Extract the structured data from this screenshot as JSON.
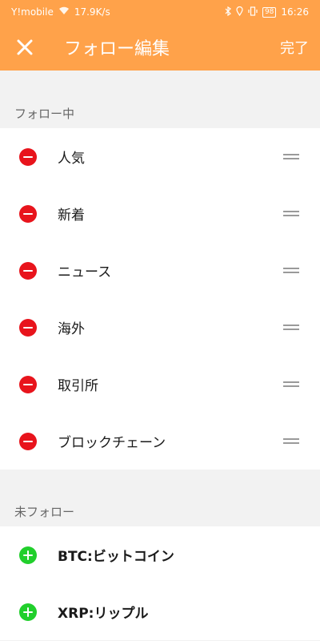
{
  "status_bar": {
    "carrier": "Y!mobile",
    "speed": "17.9K/s",
    "battery": "98",
    "time": "16:26"
  },
  "header": {
    "title": "フォロー編集",
    "done_label": "完了",
    "close_icon": "close-icon"
  },
  "following": {
    "section_label": "フォロー中",
    "items": [
      {
        "label": "人気"
      },
      {
        "label": "新着"
      },
      {
        "label": "ニュース"
      },
      {
        "label": "海外"
      },
      {
        "label": "取引所"
      },
      {
        "label": "ブロックチェーン"
      }
    ]
  },
  "unfollowed": {
    "section_label": "未フォロー",
    "items": [
      {
        "label": "BTC:ビットコイン"
      },
      {
        "label": "XRP:リップル"
      }
    ]
  },
  "colors": {
    "accent": "#ffa24a",
    "remove": "#e8141c",
    "add": "#21cf2c"
  }
}
